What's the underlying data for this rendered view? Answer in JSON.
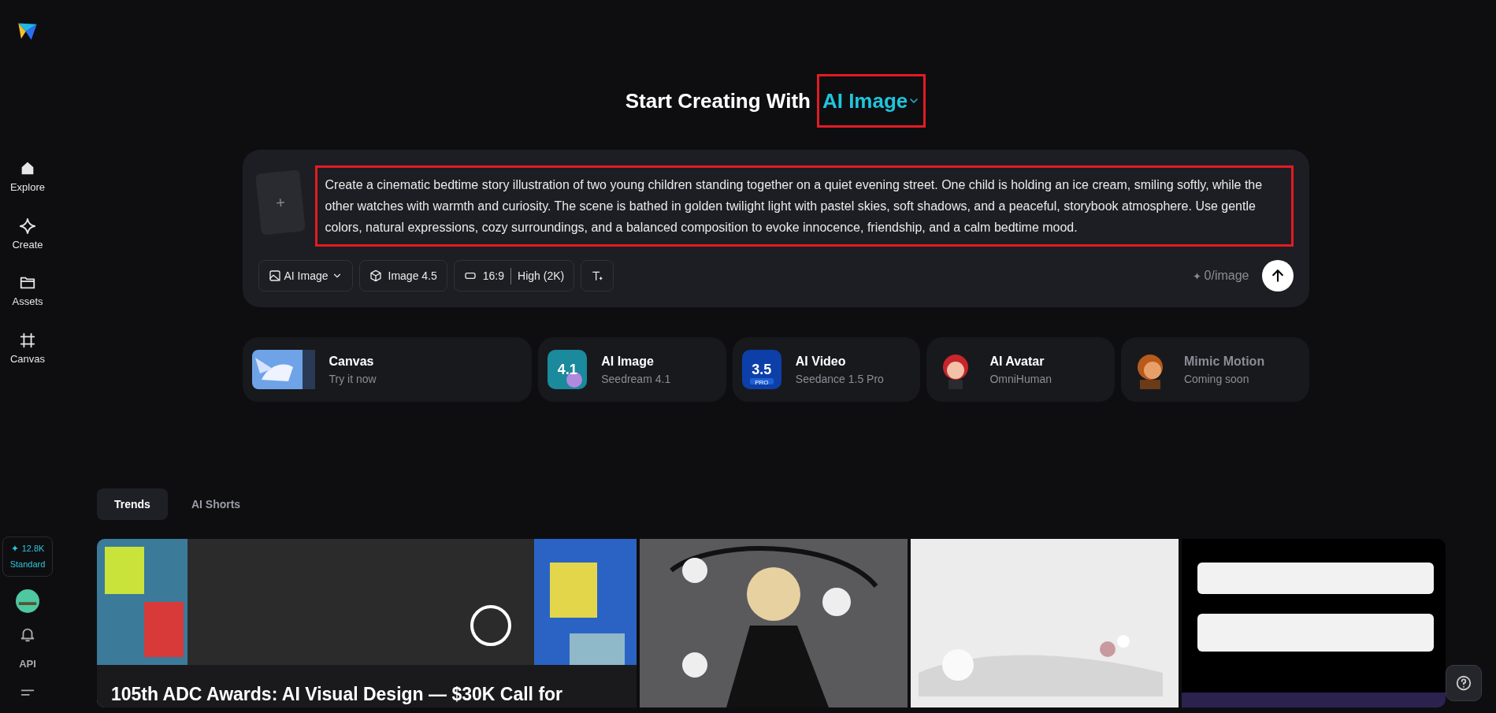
{
  "sidebar": {
    "items": [
      {
        "label": "Explore"
      },
      {
        "label": "Create"
      },
      {
        "label": "Assets"
      },
      {
        "label": "Canvas"
      }
    ],
    "credits": {
      "amount": "12.8K",
      "plan": "Standard"
    },
    "api": "API"
  },
  "heading": {
    "text": "Start Creating With",
    "mode": "AI Image"
  },
  "prompt": {
    "add": "+",
    "value": "Create a cinematic bedtime story illustration of two young children standing together on a quiet evening street. One child is holding an ice cream, smiling softly, while the other watches with warmth and curiosity. The scene is bathed in golden twilight light with pastel skies, soft shadows, and a peaceful, storybook atmosphere. Use gentle colors, natural expressions, cozy surroundings, and a balanced composition to evoke innocence, friendship, and a calm bedtime mood.",
    "toolbar": [
      {
        "kind": "mode",
        "label": "AI Image"
      },
      {
        "kind": "model",
        "label": "Image 4.5"
      },
      {
        "kind": "ratio",
        "label": "16:9",
        "quality": "High (2K)"
      },
      {
        "kind": "text"
      }
    ],
    "cost": "0/image"
  },
  "features": [
    {
      "title": "Canvas",
      "subtitle": "Try it now",
      "disabled": false
    },
    {
      "title": "AI Image",
      "subtitle": "Seedream 4.1",
      "badge": "4.1",
      "disabled": false
    },
    {
      "title": "AI Video",
      "subtitle": "Seedance 1.5 Pro",
      "badge": "3.5",
      "badge_sub": "PRO",
      "disabled": false
    },
    {
      "title": "AI Avatar",
      "subtitle": "OmniHuman",
      "disabled": false
    },
    {
      "title": "Mimic Motion",
      "subtitle": "Coming soon",
      "disabled": true
    }
  ],
  "tabs": [
    {
      "label": "Trends",
      "selected": true
    },
    {
      "label": "AI Shorts",
      "selected": false
    }
  ],
  "gallery": [
    {
      "kind": "picture",
      "caption": "105th ADC Awards: AI Visual Design — $30K Call for"
    },
    {
      "kind": "picture"
    },
    {
      "kind": "picture"
    },
    {
      "kind": "picture"
    }
  ]
}
